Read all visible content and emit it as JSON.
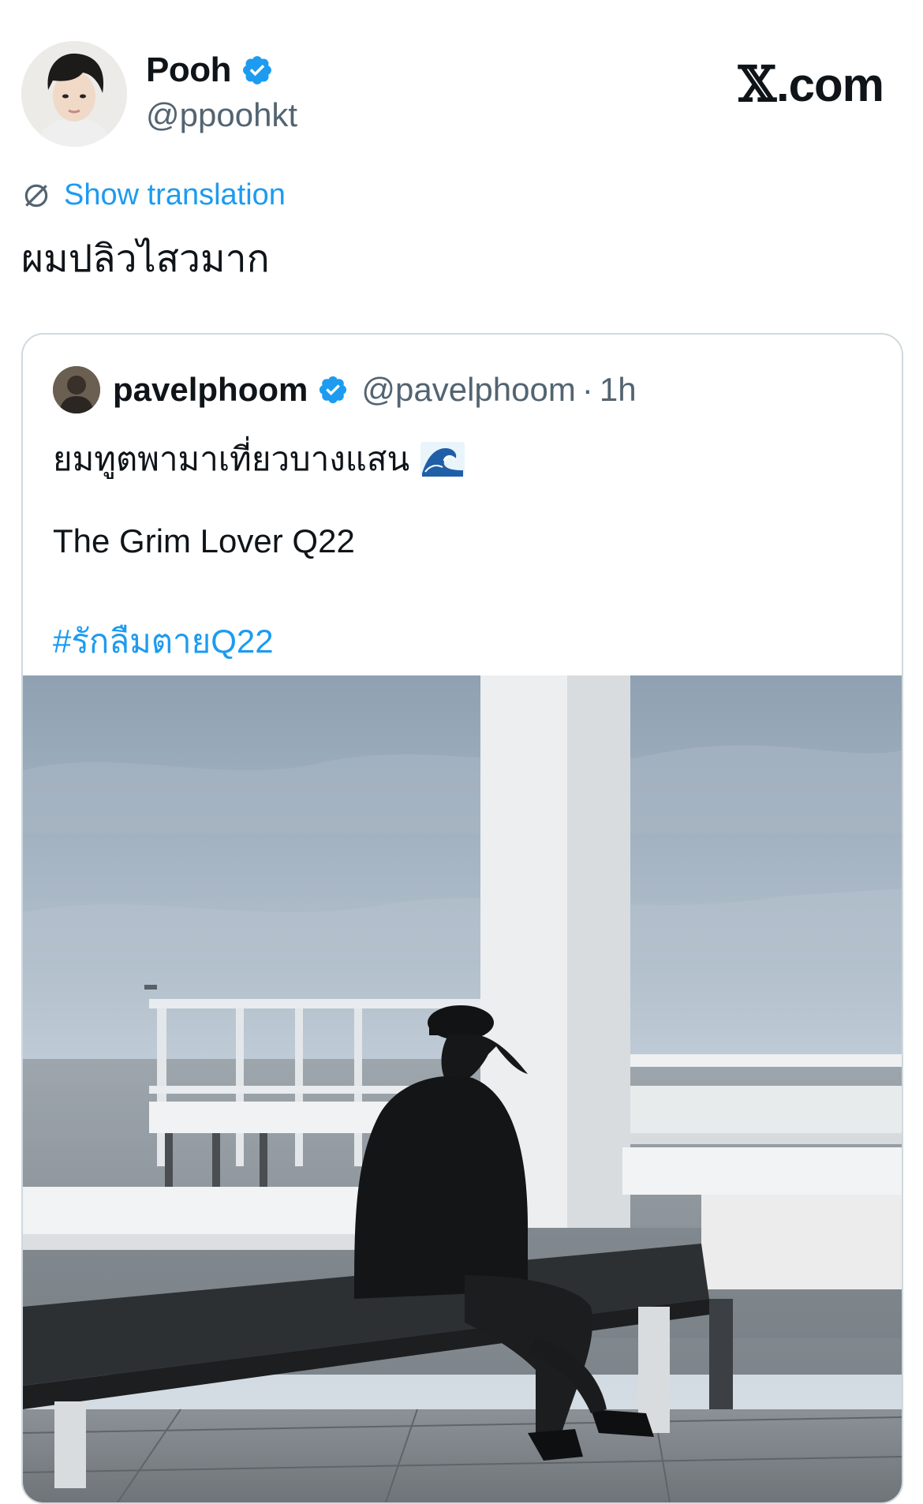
{
  "author": {
    "name": "Pooh",
    "handle": "@ppoohkt",
    "verified_icon": "verified-badge-icon"
  },
  "site_badge": {
    "x_glyph": "𝕏",
    "text": ".com"
  },
  "translation": {
    "label": "Show translation",
    "icon": "translate-icon"
  },
  "tweet": {
    "text": "ผมปลิวไสวมาก"
  },
  "quoted": {
    "name": "pavelphoom",
    "handle": "@pavelphoom",
    "separator": "·",
    "time": "1h",
    "line1": "ยมทูตพามาเที่ยวบางแสน",
    "line1_emoji": "wave-emoji",
    "line2": "The Grim Lover Q22",
    "hashtag": "#รักลืมตายQ22"
  },
  "colors": {
    "accent_blue": "#1d9bf0",
    "muted": "#536471",
    "border": "#cfd9de"
  }
}
